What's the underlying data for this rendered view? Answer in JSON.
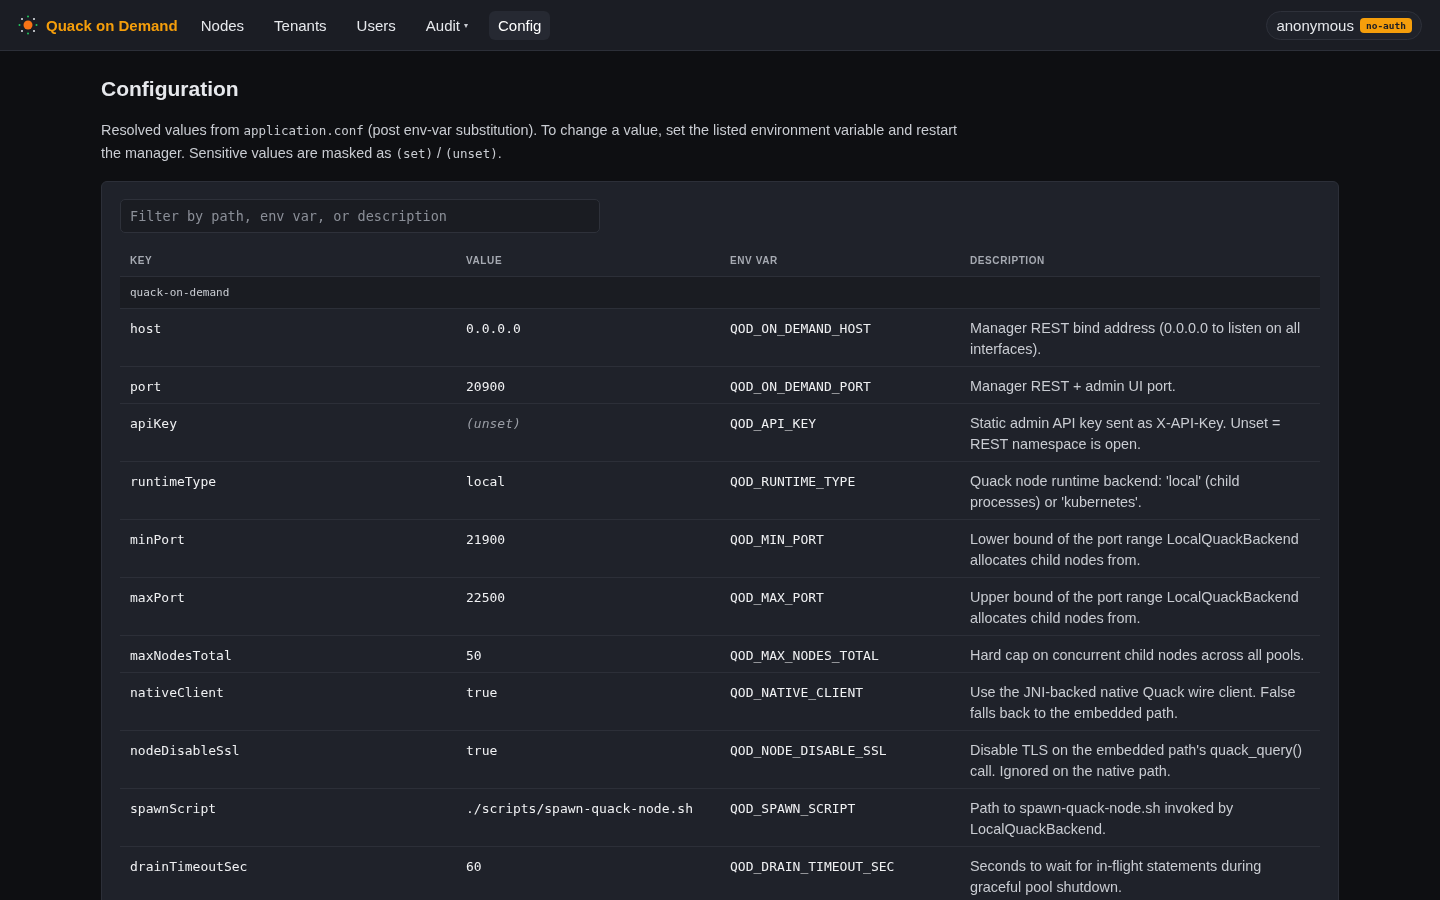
{
  "nav": {
    "brand": "Quack on Demand",
    "links": [
      {
        "label": "Nodes",
        "selected": false
      },
      {
        "label": "Tenants",
        "selected": false
      },
      {
        "label": "Users",
        "selected": false
      },
      {
        "label": "Audit",
        "selected": false,
        "caret": "▾"
      },
      {
        "label": "Config",
        "selected": true
      }
    ],
    "user": {
      "name": "anonymous",
      "badge": "no-auth"
    }
  },
  "page": {
    "title": "Configuration",
    "intro": [
      {
        "kind": "text",
        "text": "Resolved values from "
      },
      {
        "kind": "code",
        "text": "application.conf"
      },
      {
        "kind": "text",
        "text": " (post env-var substitution). To change a value, set the listed environment variable and restart the manager. Sensitive values are masked as "
      },
      {
        "kind": "code",
        "text": "(set)"
      },
      {
        "kind": "text",
        "text": " / "
      },
      {
        "kind": "code",
        "text": "(unset)"
      },
      {
        "kind": "text",
        "text": "."
      }
    ]
  },
  "filter": {
    "placeholder": "Filter by path, env var, or description"
  },
  "table": {
    "columns": [
      "KEY",
      "VALUE",
      "ENV VAR",
      "DESCRIPTION"
    ],
    "groups": [
      {
        "name": "quack-on-demand",
        "rows": [
          {
            "key": "host",
            "value": "0.0.0.0",
            "masked": false,
            "env": "QOD_ON_DEMAND_HOST",
            "description": "Manager REST bind address (0.0.0.0 to listen on all interfaces)."
          },
          {
            "key": "port",
            "value": "20900",
            "masked": false,
            "env": "QOD_ON_DEMAND_PORT",
            "description": "Manager REST + admin UI port."
          },
          {
            "key": "apiKey",
            "value": "(unset)",
            "masked": true,
            "env": "QOD_API_KEY",
            "description": "Static admin API key sent as X-API-Key. Unset = REST namespace is open."
          },
          {
            "key": "runtimeType",
            "value": "local",
            "masked": false,
            "env": "QOD_RUNTIME_TYPE",
            "description": "Quack node runtime backend: 'local' (child processes) or 'kubernetes'."
          },
          {
            "key": "minPort",
            "value": "21900",
            "masked": false,
            "env": "QOD_MIN_PORT",
            "description": "Lower bound of the port range LocalQuackBackend allocates child nodes from."
          },
          {
            "key": "maxPort",
            "value": "22500",
            "masked": false,
            "env": "QOD_MAX_PORT",
            "description": "Upper bound of the port range LocalQuackBackend allocates child nodes from."
          },
          {
            "key": "maxNodesTotal",
            "value": "50",
            "masked": false,
            "env": "QOD_MAX_NODES_TOTAL",
            "description": "Hard cap on concurrent child nodes across all pools."
          },
          {
            "key": "nativeClient",
            "value": "true",
            "masked": false,
            "env": "QOD_NATIVE_CLIENT",
            "description": "Use the JNI-backed native Quack wire client. False falls back to the embedded path."
          },
          {
            "key": "nodeDisableSsl",
            "value": "true",
            "masked": false,
            "env": "QOD_NODE_DISABLE_SSL",
            "description": "Disable TLS on the embedded path's quack_query() call. Ignored on the native path."
          },
          {
            "key": "spawnScript",
            "value": "./scripts/spawn-quack-node.sh",
            "masked": false,
            "env": "QOD_SPAWN_SCRIPT",
            "description": "Path to spawn-quack-node.sh invoked by LocalQuackBackend."
          },
          {
            "key": "drainTimeoutSec",
            "value": "60",
            "masked": false,
            "env": "QOD_DRAIN_TIMEOUT_SEC",
            "description": "Seconds to wait for in-flight statements during graceful pool shutdown."
          }
        ]
      }
    ]
  }
}
